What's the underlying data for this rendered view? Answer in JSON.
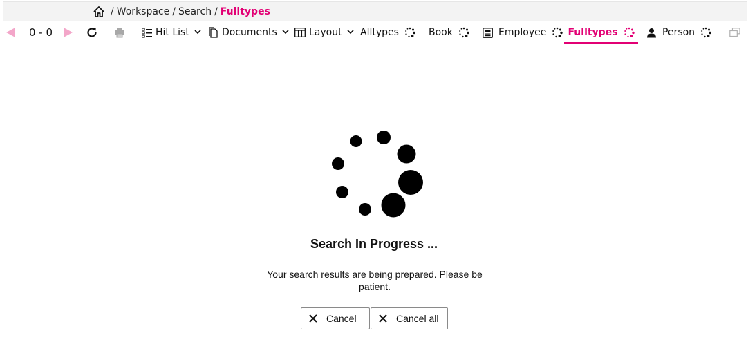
{
  "breadcrumb": {
    "items": [
      "Workspace",
      "Search",
      "Fulltypes"
    ],
    "separator": "/"
  },
  "toolbar": {
    "counter": "0 - 0",
    "menus": {
      "hitlist": "Hit List",
      "documents": "Documents",
      "layout": "Layout"
    },
    "tabs": {
      "alltypes": "Alltypes",
      "book": "Book",
      "employee": "Employee",
      "fulltypes": "Fulltypes",
      "person": "Person"
    },
    "active_tab": "Fulltypes"
  },
  "main": {
    "title": "Search In Progress ...",
    "message": "Your search results are being prepared. Please be patient.",
    "cancel_label": "Cancel",
    "cancel_all_label": "Cancel all"
  },
  "colors": {
    "accent": "#e20074",
    "nav_disabled": "#f3a6c9",
    "crumb_bg": "#f3f3f3"
  },
  "icons": {
    "home": "home-icon",
    "prev": "prev-arrow-icon",
    "next": "next-arrow-icon",
    "refresh": "refresh-icon",
    "print": "print-icon",
    "hitlist": "list-icon",
    "documents": "document-icon",
    "layout": "table-icon",
    "employee": "id-card-icon",
    "person": "person-icon",
    "loading": "spinner-icon",
    "cancel": "close-icon",
    "window": "window-restore-icon"
  }
}
